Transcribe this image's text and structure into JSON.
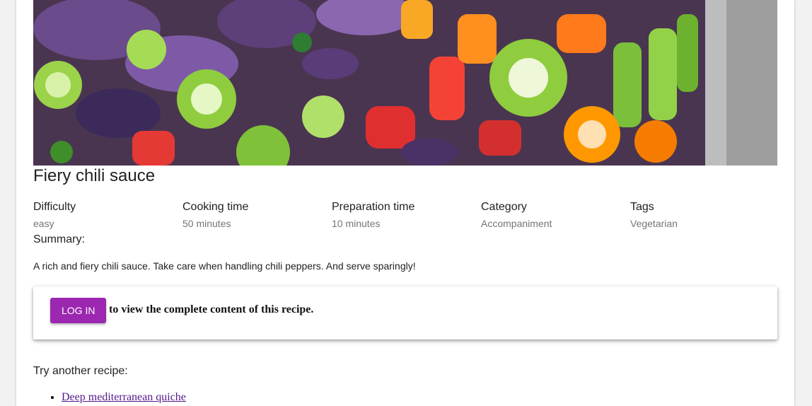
{
  "recipe": {
    "image_alt": "Sliced colorful chili peppers and red onion",
    "title": "Fiery chili sauce",
    "meta": [
      {
        "label": "Difficulty",
        "value": "easy"
      },
      {
        "label": "Cooking time",
        "value": "50 minutes"
      },
      {
        "label": "Preparation time",
        "value": "10 minutes"
      },
      {
        "label": "Category",
        "value": "Accompaniment"
      },
      {
        "label": "Tags",
        "value": "Vegetarian"
      }
    ],
    "summary_label": "Summary:",
    "summary_text": "A rich and fiery chili sauce. Take care when handling chili peppers. And serve sparingly!"
  },
  "login_prompt": {
    "button_label": "LOG IN",
    "text": "to view the complete content of this recipe.",
    "accent_color": "#9c27b0"
  },
  "related": {
    "label": "Try another recipe:",
    "items": [
      {
        "label": "Deep mediterranean quiche"
      }
    ]
  }
}
